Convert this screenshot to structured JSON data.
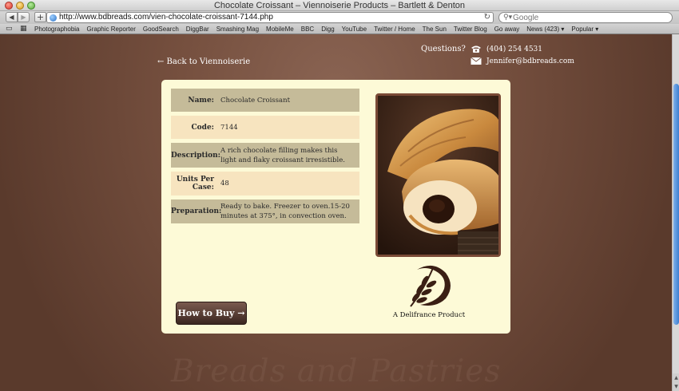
{
  "window": {
    "title": "Chocolate Croissant – Viennoiserie Products – Bartlett & Denton"
  },
  "toolbar": {
    "url": "http://www.bdbreads.com/vien-chocolate-croissant-7144.php",
    "search_placeholder": "Google"
  },
  "bookmarks": [
    "Photographobia",
    "Graphic Reporter",
    "GoodSearch",
    "DiggBar",
    "Smashing Mag",
    "MobileMe",
    "BBC",
    "Digg",
    "YouTube",
    "Twitter / Home",
    "The Sun",
    "Twitter Blog",
    "Go away",
    "News (423) ▾",
    "Popular ▾"
  ],
  "page": {
    "back_link": "← Back to Viennoiserie",
    "questions": "Questions?",
    "phone": "(404) 254 4531",
    "email": "Jennifer@bdbreads.com",
    "buy_button": "How to Buy →",
    "logo_caption": "A Delifrance Product",
    "watermark": "Breads and Pastries",
    "details": {
      "name_label": "Name:",
      "name_value": "Chocolate Croissant",
      "code_label": "Code:",
      "code_value": "7144",
      "description_label": "Description:",
      "description_value": "A rich chocolate filling makes this light and flaky croissant irresistible.",
      "units_label": "Units Per Case:",
      "units_value": "48",
      "preparation_label": "Preparation:",
      "preparation_value": "Ready to bake. Freezer to oven.15-20 minutes at 375°, in convection oven."
    }
  },
  "colors": {
    "page_background": "#76503f",
    "card_background": "#fdfad7",
    "row_dark": "#c5bb99",
    "row_light": "#f7e4bf",
    "button": "#4a3028",
    "scroll_thumb": "#3d7fd1"
  },
  "icons": [
    "back-icon",
    "forward-icon",
    "add-bookmark-icon",
    "globe-icon",
    "reload-icon",
    "search-icon",
    "bookmarks-book-icon",
    "top-sites-grid-icon",
    "phone-icon",
    "mail-icon",
    "wheat-logo-icon"
  ]
}
